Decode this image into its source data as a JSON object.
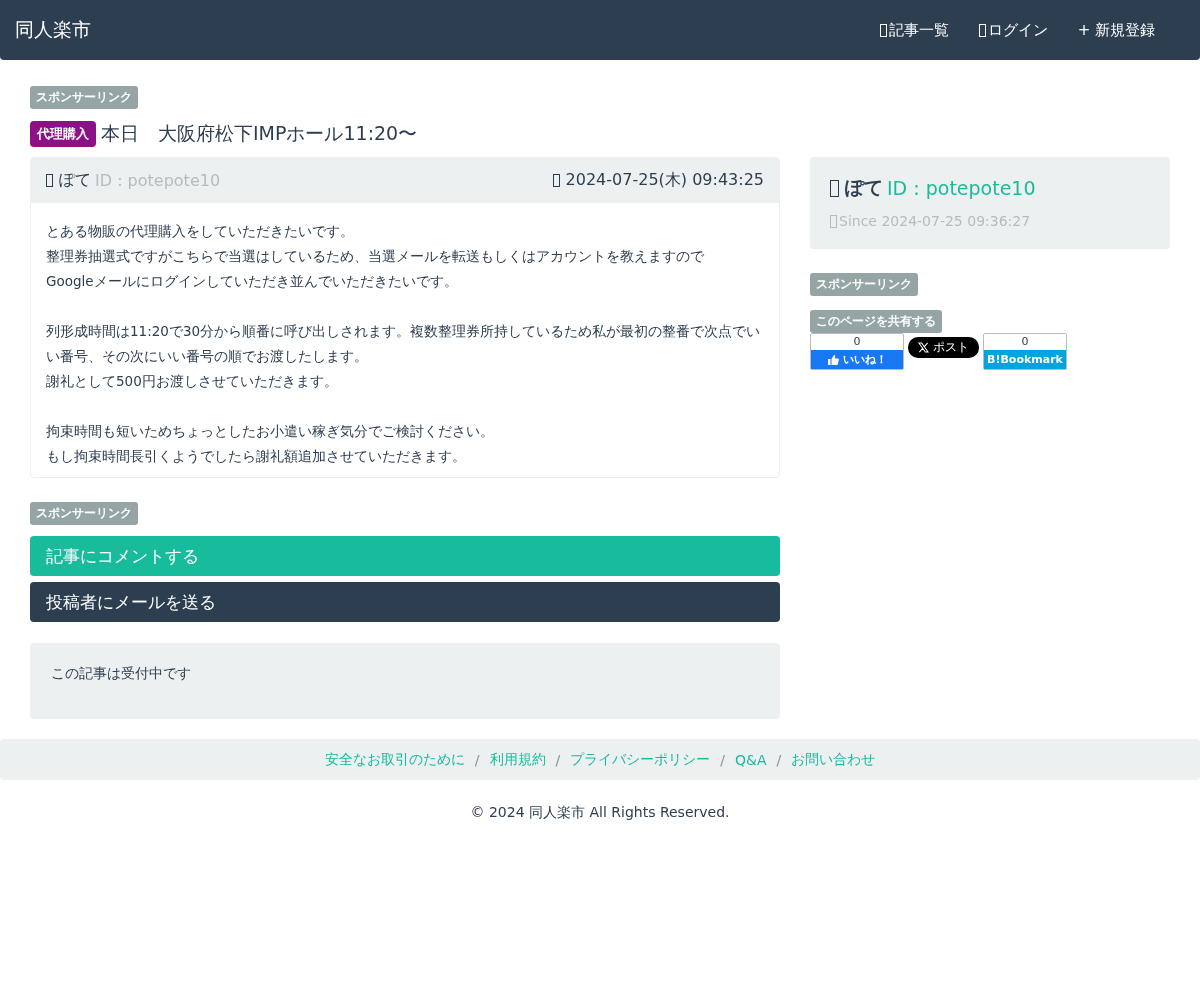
{
  "navbar": {
    "brand": "同人楽市",
    "links": [
      {
        "label": "記事一覧",
        "kind": "icon-link"
      },
      {
        "label": "ログイン",
        "kind": "icon-link"
      },
      {
        "label": "+ 新規登録",
        "kind": "text-link"
      }
    ]
  },
  "sponsor_top": "スポンサーリンク",
  "article": {
    "category": "代理購入",
    "title": "本日　大阪府松下IMPホール11:20〜",
    "author": "ぽて",
    "author_id": "ID : potepote10",
    "posted": "2024-07-25(木) 09:43:25",
    "paragraphs": [
      {
        "lines": [
          "とある物販の代理購入をしていただきたいです。",
          "整理券抽選式ですがこちらで当選はしているため、当選メールを転送もしくはアカウントを教えますので",
          "Googleメールにログインしていただき並んでいただきたいです。"
        ]
      },
      {
        "lines": [
          "列形成時間は11:20で30分から順番に呼び出しされます。複数整理券所持しているため私が最初の整番で次点でいい番号、その次にいい番号の順でお渡したします。",
          "謝礼として500円お渡しさせていただきます。"
        ]
      },
      {
        "lines": [
          "拘束時間も短いためちょっとしたお小遣い稼ぎ気分でご検討ください。",
          "もし拘束時間長引くようでしたら謝礼額追加させていただきます。"
        ]
      }
    ]
  },
  "sponsor_bottom": "スポンサーリンク",
  "actions": [
    {
      "label": "記事にコメントする",
      "kind": "primary"
    },
    {
      "label": "投稿者にメールを送る",
      "kind": "dark"
    }
  ],
  "status_note": "この記事は受付中です",
  "sidebar": {
    "name": "ぽて",
    "id": "ID : potepote10",
    "since": "Since 2024-07-25 09:36:27",
    "sponsor": "スポンサーリンク",
    "share_label": "このページを共有する",
    "share": [
      {
        "kind": "facebook",
        "count": "0",
        "label": "いいね！"
      },
      {
        "kind": "x",
        "label": "ポスト"
      },
      {
        "kind": "hatena",
        "count": "0",
        "logo": "B!",
        "label": "Bookmark"
      }
    ]
  },
  "footer": {
    "items": [
      {
        "kind": "link",
        "label": "安全なお取引のために"
      },
      {
        "kind": "separator",
        "label": "/"
      },
      {
        "kind": "link",
        "label": "利用規約"
      },
      {
        "kind": "separator",
        "label": "/"
      },
      {
        "kind": "link",
        "label": "プライバシーポリシー"
      },
      {
        "kind": "separator",
        "label": "/"
      },
      {
        "kind": "link",
        "label": "Q&A"
      },
      {
        "kind": "separator",
        "label": "/"
      },
      {
        "kind": "link",
        "label": "お問い合わせ"
      }
    ],
    "copyright": "© 2024 同人楽市 All Rights Reserved."
  }
}
